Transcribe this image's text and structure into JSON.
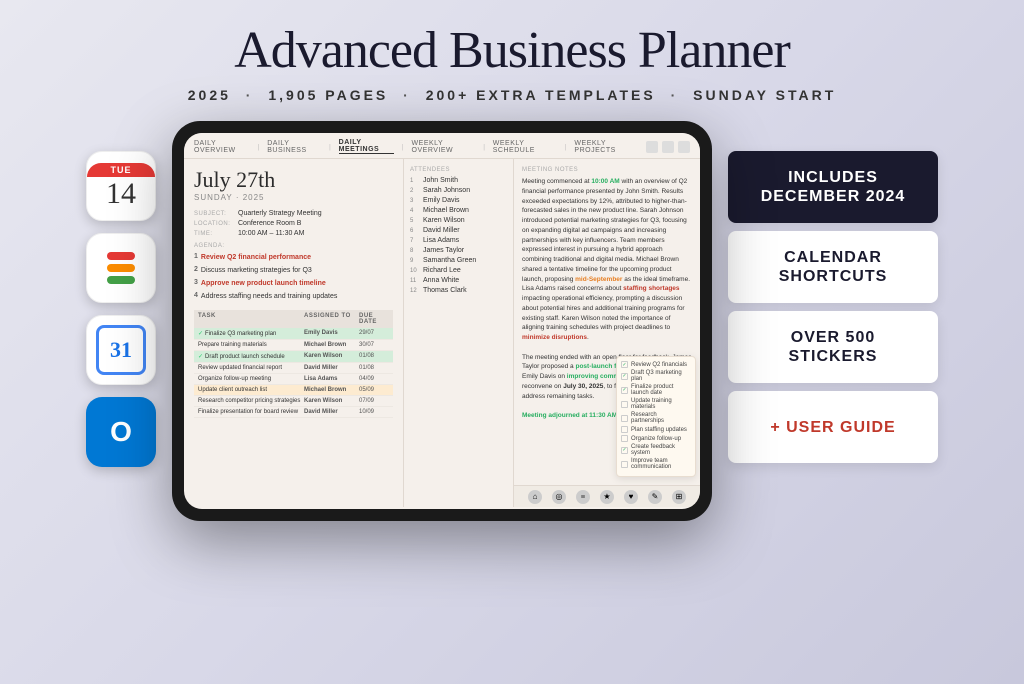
{
  "header": {
    "title": "Advanced Business Planner",
    "subtitle_parts": [
      "2025",
      "1,905 PAGES",
      "200+ EXTRA TEMPLATES",
      "SUNDAY START"
    ]
  },
  "app_icons": [
    {
      "name": "Calendar",
      "type": "calendar",
      "day": "TUE",
      "num": "14"
    },
    {
      "name": "Reminders",
      "type": "reminders"
    },
    {
      "name": "Google Calendar",
      "type": "gcal",
      "num": "31"
    },
    {
      "name": "Outlook",
      "type": "outlook",
      "letter": "O"
    }
  ],
  "tablet": {
    "nav_items": [
      "DAILY OVERVIEW",
      "DAILY BUSINESS",
      "DAILY MEETINGS",
      "WEEKLY OVERVIEW",
      "WEEKLY SCHEDULE",
      "WEEKLY PROJECTS"
    ],
    "active_nav": "DAILY MEETINGS",
    "date": "July 27th",
    "date_sub": "SUNDAY · 2025",
    "subject": "Quarterly Strategy Meeting",
    "location": "Conference Room B",
    "time": "10:00 AM – 11:30 AM",
    "agenda": [
      {
        "num": "1",
        "text": "Review Q2 financial performance",
        "highlight": true
      },
      {
        "num": "2",
        "text": "Discuss marketing strategies for Q3",
        "highlight": false
      },
      {
        "num": "3",
        "text": "Approve new product launch timeline",
        "highlight": true
      },
      {
        "num": "4",
        "text": "Address staffing needs and training updates",
        "highlight": false
      }
    ],
    "attendees": [
      "John Smith",
      "Sarah Johnson",
      "Emily Davis",
      "Michael Brown",
      "Karen Wilson",
      "David Miller",
      "Lisa Adams",
      "James Taylor",
      "Samantha Green",
      "Richard Lee",
      "Anna White",
      "Thomas Clark"
    ],
    "meeting_notes": "Meeting commenced at 10:00 AM with an overview of Q2 financial performance presented by John Smith. Results exceeded expectations by 12%, attributed to higher-than-forecasted sales in the new product line. Sarah Johnson introduced potential marketing strategies for Q3, focusing on expanding digital ad campaigns and increasing partnerships with key influencers. Team members expressed interest in pursuing a hybrid approach combining traditional and digital media. Michael Brown shared a tentative timeline for the upcoming product launch, proposing mid-September as the ideal timeframe. Lisa Adams raised concerns about staffing shortages impacting operational efficiency, prompting a discussion about potential hires and additional training programs for existing staff. Karen Wilson noted the importance of aligning training schedules with project deadlines to minimize disruptions.\n\nThe meeting ended with an open floor for feedback. James Taylor proposed a post-launch feedback system, and Emily Davis on improving communication. The team will reconvene on July 30, 2025, to finalize Q3 plans and address remaining tasks.\n\nMeeting adjourned at 11:30 AM.",
    "tasks": [
      {
        "name": "Finalize Q3 marketing plan",
        "check": true,
        "assigned": "Emily Davis",
        "due": "29/07",
        "bg": "green"
      },
      {
        "name": "Prepare training materials",
        "check": false,
        "assigned": "Michael Brown",
        "due": "30/07",
        "bg": "none"
      },
      {
        "name": "Draft product launch schedule",
        "check": true,
        "assigned": "Karen Wilson",
        "due": "01/08",
        "bg": "green"
      },
      {
        "name": "Review updated financial report",
        "check": false,
        "assigned": "David Miller",
        "due": "01/08",
        "bg": "none"
      },
      {
        "name": "Organize follow-up meeting",
        "check": false,
        "assigned": "Lisa Adams",
        "due": "04/09",
        "bg": "none"
      },
      {
        "name": "Update client outreach list",
        "check": false,
        "assigned": "Michael Brown",
        "due": "05/09",
        "bg": "orange"
      },
      {
        "name": "Research competitor pricing strategies",
        "check": false,
        "assigned": "Karen Wilson",
        "due": "07/09",
        "bg": "none"
      },
      {
        "name": "Finalize presentation for board review",
        "check": false,
        "assigned": "David Miller",
        "due": "10/09",
        "bg": "none"
      }
    ],
    "checklist": [
      {
        "checked": true,
        "text": "Review Q2 financials"
      },
      {
        "checked": true,
        "text": "Draft Q3 marketing plan"
      },
      {
        "checked": true,
        "text": "Finalize product launch date"
      },
      {
        "checked": false,
        "text": "Update training materials"
      },
      {
        "checked": false,
        "text": "Research partnerships"
      },
      {
        "checked": false,
        "text": "Plan staffing updates"
      },
      {
        "checked": false,
        "text": "Organize follow-up"
      },
      {
        "checked": true,
        "text": "Create feedback system"
      },
      {
        "checked": false,
        "text": "Improve team communication"
      }
    ]
  },
  "feature_cards": [
    {
      "text": "INCLUDES DECEMBER 2024",
      "style": "dark"
    },
    {
      "text": "CALENDAR SHORTCUTS",
      "style": "light"
    },
    {
      "text": "OVER 500 STICKERS",
      "style": "light"
    },
    {
      "text": "+ USER GUIDE",
      "style": "red"
    }
  ]
}
